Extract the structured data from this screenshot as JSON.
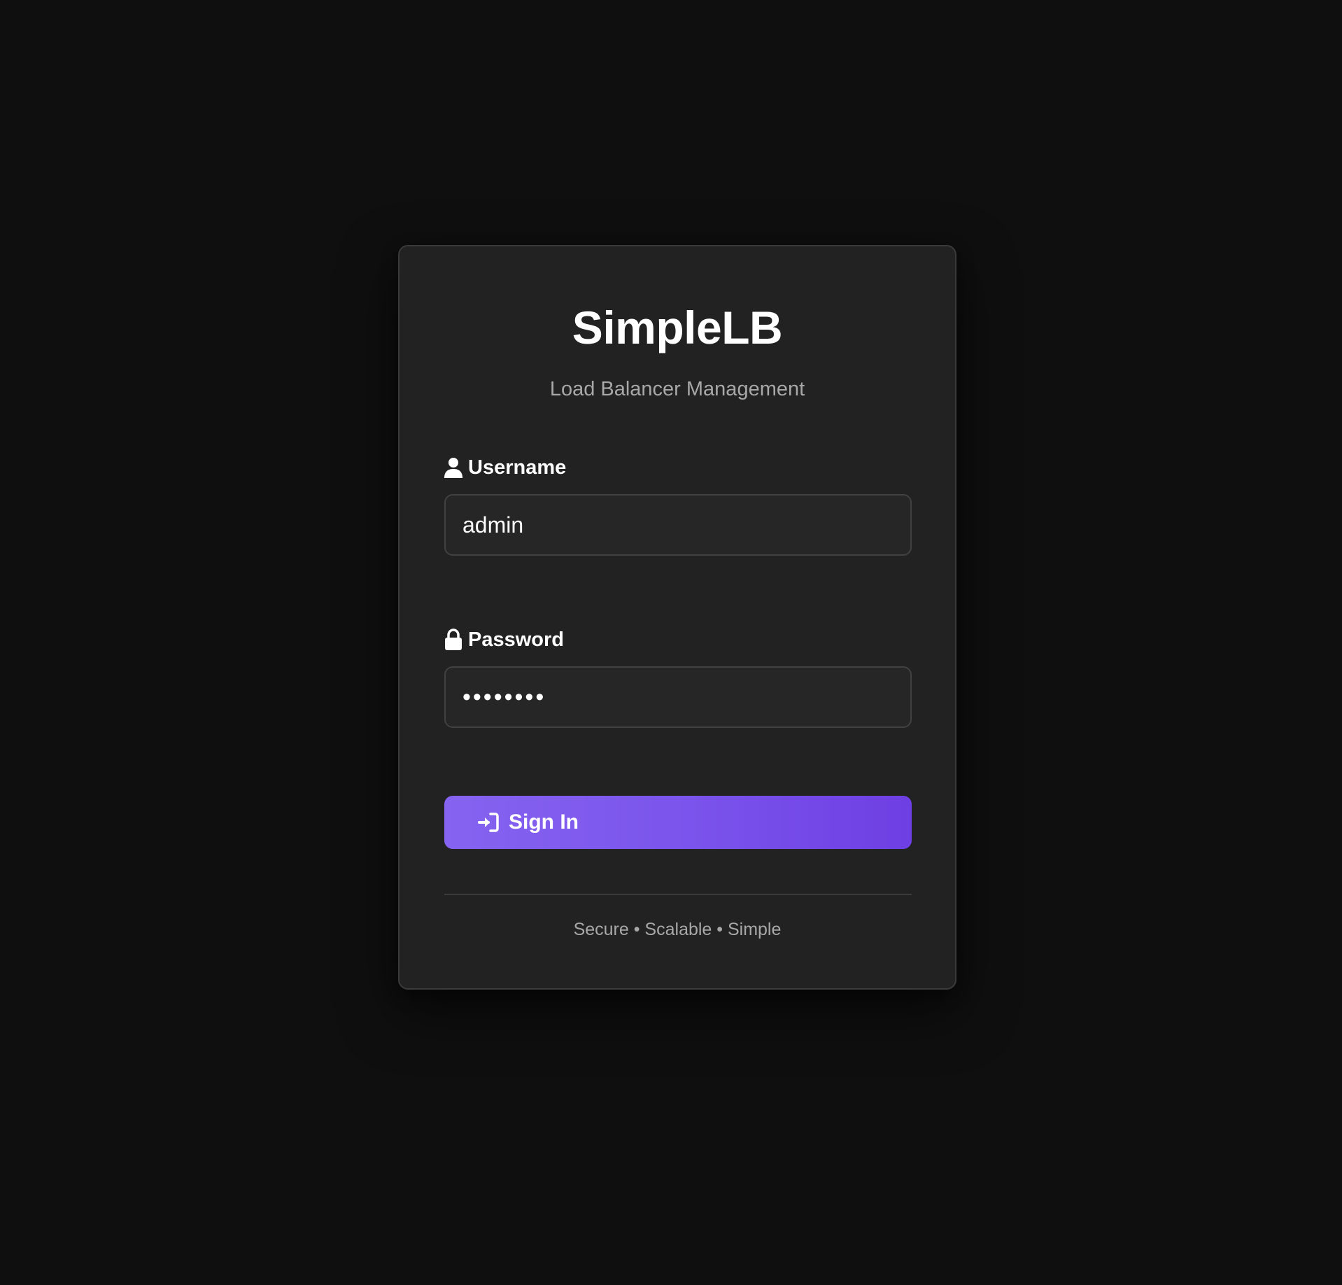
{
  "app": {
    "title": "SimpleLB",
    "subtitle": "Load Balancer Management"
  },
  "form": {
    "username": {
      "label": "Username",
      "icon": "user-icon",
      "value": "admin"
    },
    "password": {
      "label": "Password",
      "icon": "lock-icon",
      "masked_value": "••••••••"
    },
    "submit": {
      "label": "Sign In",
      "icon": "sign-in-icon"
    }
  },
  "footer": {
    "tagline": "Secure • Scalable • Simple"
  },
  "colors": {
    "background": "#0f0f0f",
    "card": "#222222",
    "accent_start": "#8663f0",
    "accent_end": "#6e3fe3",
    "muted_text": "#a8a8a8"
  }
}
